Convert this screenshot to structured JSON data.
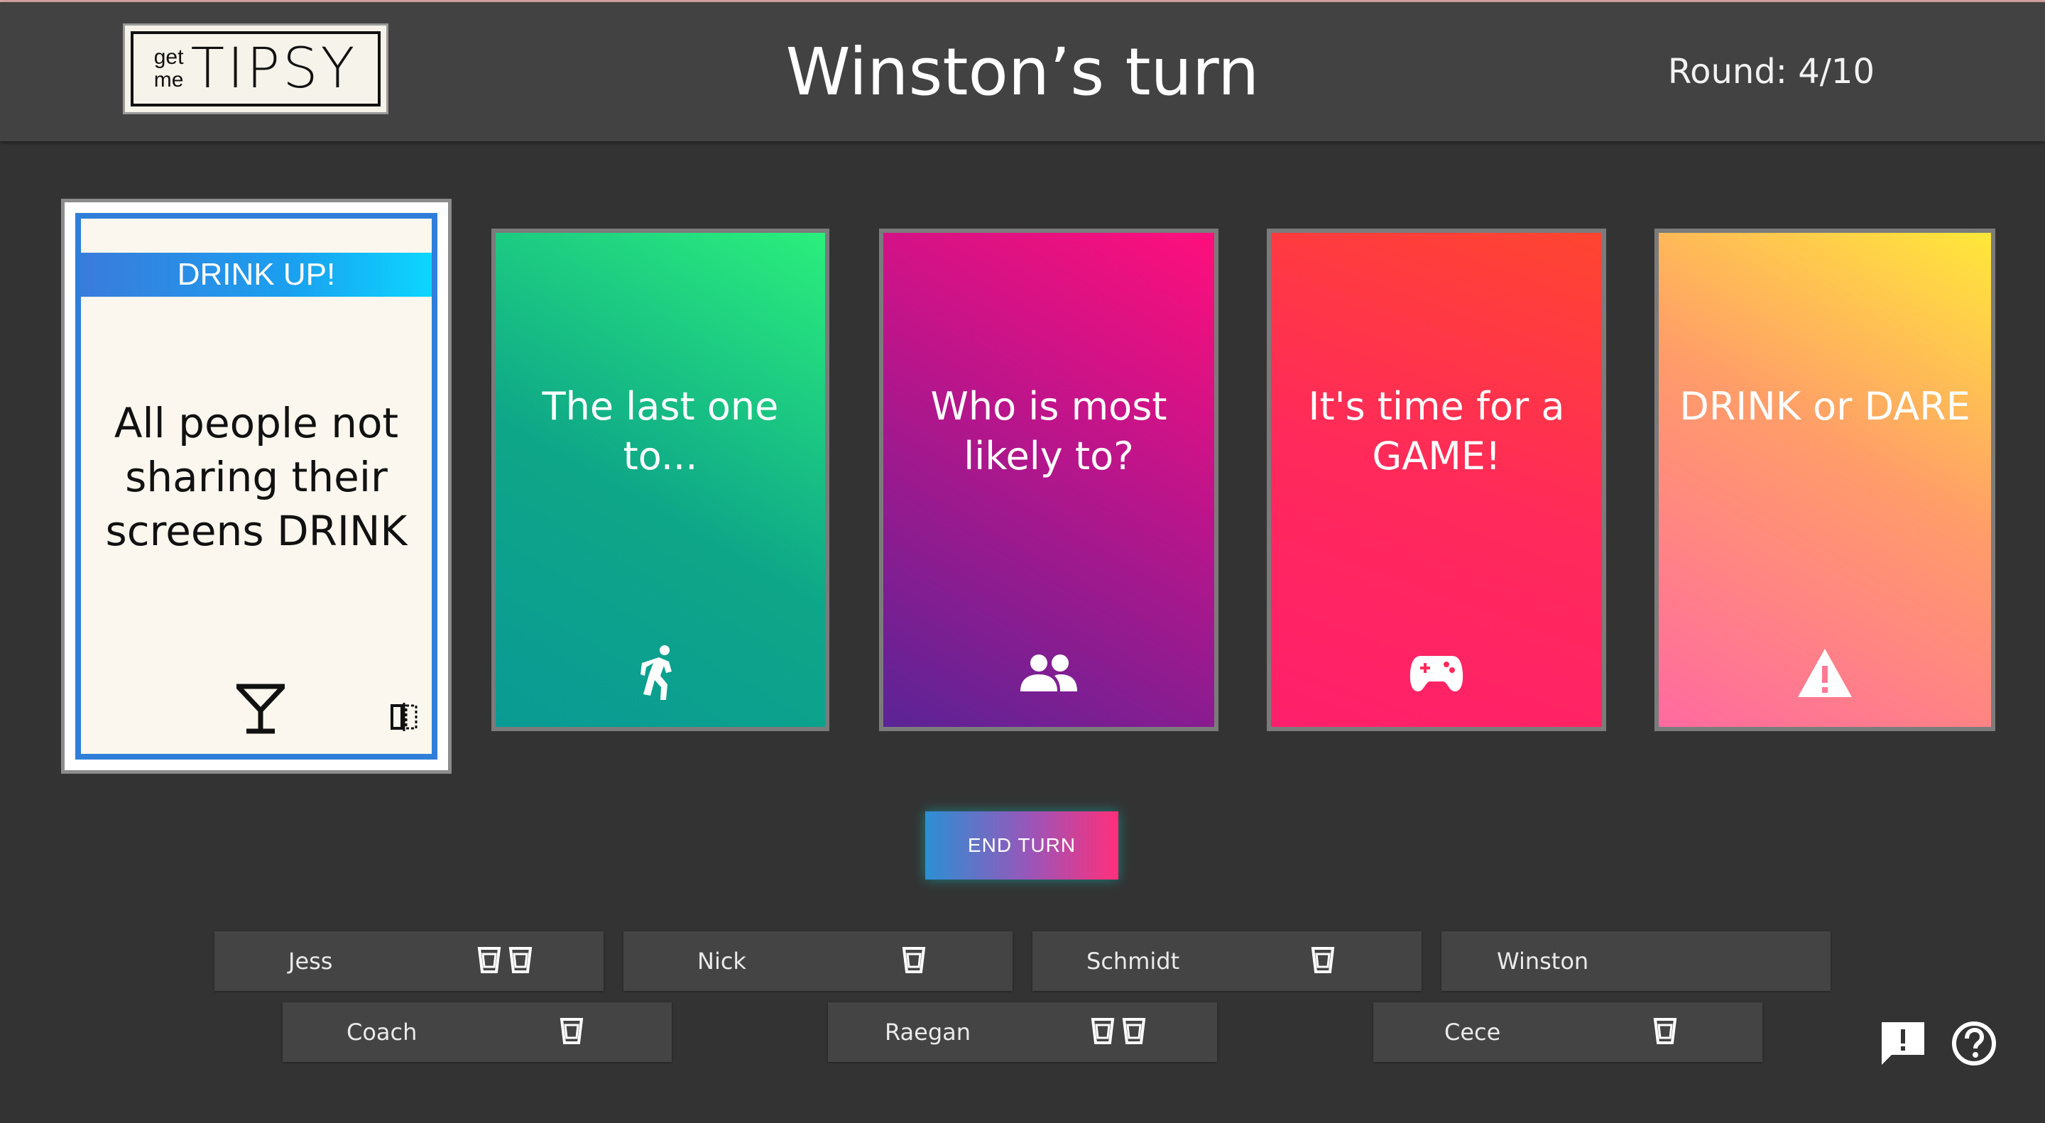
{
  "header": {
    "logo_small_top": "get",
    "logo_small_bottom": "me",
    "logo_big": "TIPSY",
    "turn_title": "Winston’s turn",
    "round_text": "Round: 4/10"
  },
  "featured_card": {
    "band_label": "DRINK UP!",
    "text_line1": "All people not",
    "text_line2": "sharing their",
    "text_line3": "screens DRINK",
    "icon": "martini-icon",
    "corner_icon": "flip-icon",
    "band_color": "#1aa0ef",
    "border_color": "#2f7fd9"
  },
  "cards": [
    {
      "line1": "The last one",
      "line2": "to...",
      "icon": "running-person-icon",
      "gradient": [
        "#2bef7c",
        "#0ea688",
        "#0a9a94"
      ]
    },
    {
      "line1": "Who is most",
      "line2": "likely to?",
      "icon": "people-icon",
      "gradient": [
        "#ff0f7b",
        "#b3148c",
        "#5a2496"
      ]
    },
    {
      "line1": "It's time for a",
      "line2": "GAME!",
      "icon": "gamepad-icon",
      "gradient": [
        "#ff4530",
        "#ff2a5a",
        "#ff1f6c"
      ]
    },
    {
      "line1": "DRINK or DARE",
      "line2": "",
      "icon": "warning-icon",
      "gradient": [
        "#ffe83a",
        "#ff9c6a",
        "#ff6aa0"
      ]
    }
  ],
  "end_turn": {
    "label": "END TURN"
  },
  "players": [
    {
      "name": "Jess",
      "cups": 2
    },
    {
      "name": "Nick",
      "cups": 1
    },
    {
      "name": "Schmidt",
      "cups": 1
    },
    {
      "name": "Winston",
      "cups": 0
    },
    {
      "name": "Coach",
      "cups": 1
    },
    {
      "name": "Raegan",
      "cups": 2
    },
    {
      "name": "Cece",
      "cups": 1
    }
  ],
  "bottom_icons": [
    "feedback-icon",
    "help-icon"
  ]
}
